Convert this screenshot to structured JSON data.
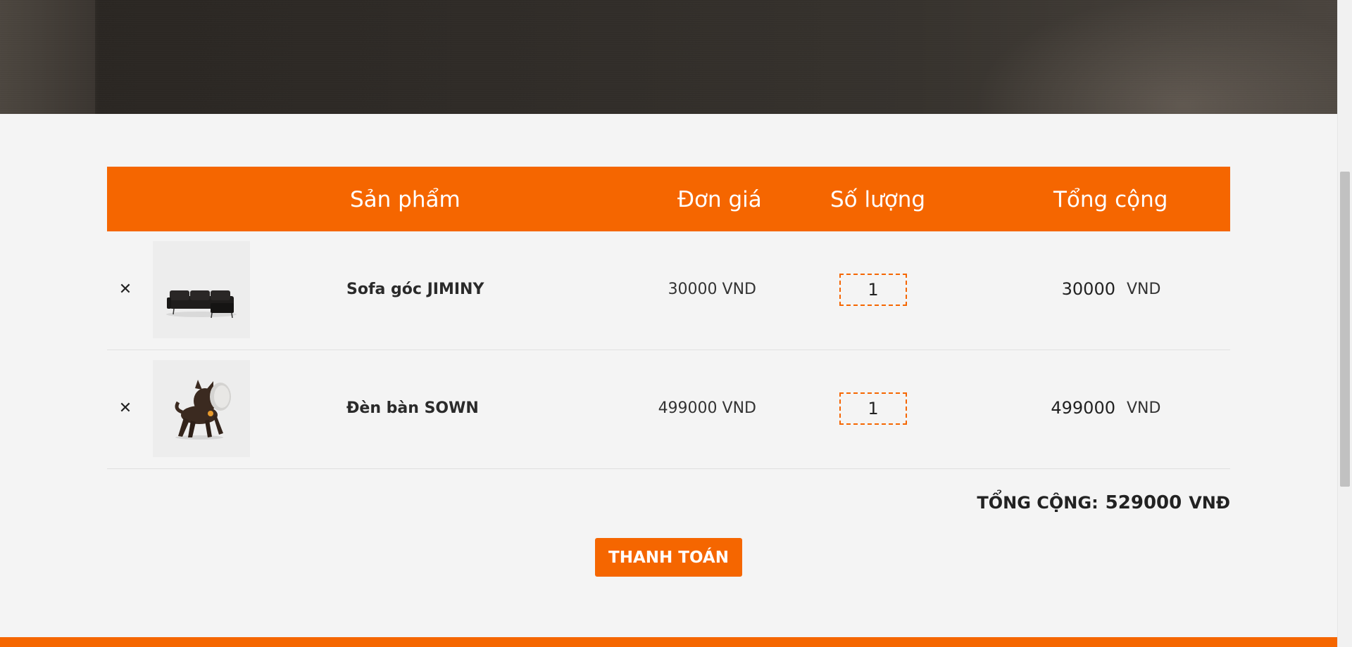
{
  "cart": {
    "headers": {
      "product": "Sản phẩm",
      "unit_price": "Đơn giá",
      "quantity": "Số lượng",
      "total": "Tổng cộng"
    },
    "items": [
      {
        "name": "Sofa góc JIMINY",
        "unit_price": "30000 VND",
        "quantity": "1",
        "line_total": "30000",
        "currency": "VND",
        "remove_icon": "close-icon",
        "image": "sofa-image"
      },
      {
        "name": "Đèn bàn SOWN",
        "unit_price": "499000 VND",
        "quantity": "1",
        "line_total": "499000",
        "currency": "VND",
        "remove_icon": "close-icon",
        "image": "dog-lamp-image"
      }
    ],
    "grand_total": {
      "label": "TỔNG CỘNG:",
      "value": "529000",
      "currency": "VNĐ"
    },
    "checkout_label": "THANH TOÁN"
  },
  "colors": {
    "accent": "#f56600",
    "background": "#f4f4f4"
  }
}
